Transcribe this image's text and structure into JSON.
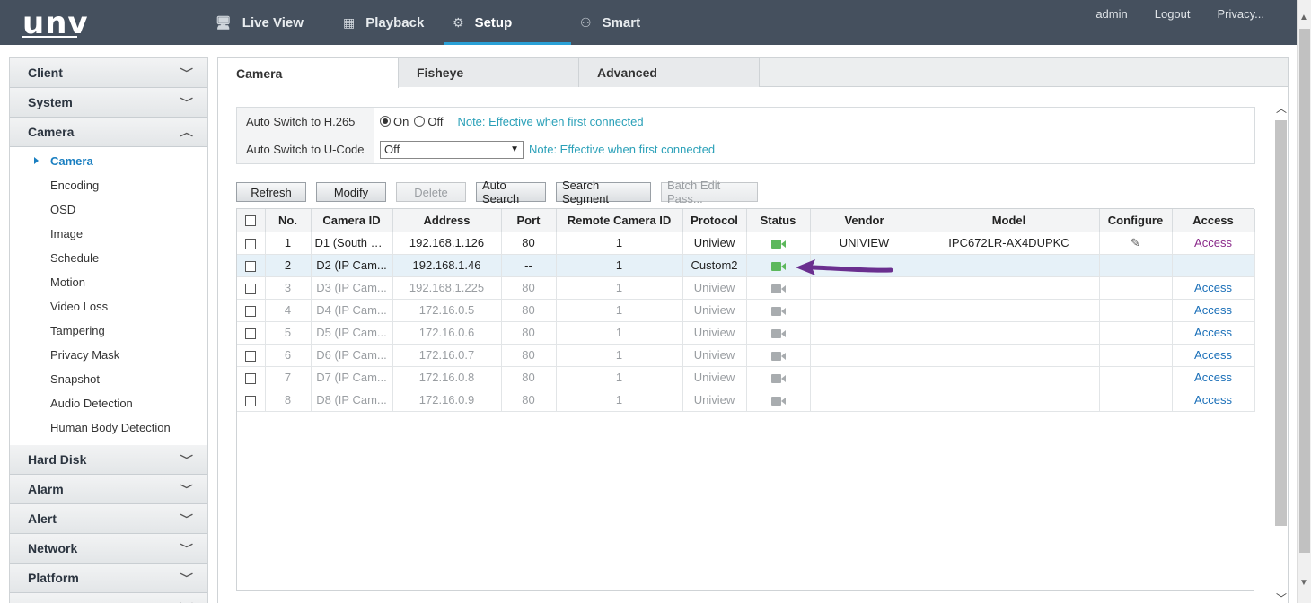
{
  "header": {
    "logo": "unv",
    "nav": [
      {
        "label": "Live View",
        "icon": "monitor-icon",
        "glyph": "🖥"
      },
      {
        "label": "Playback",
        "icon": "film-icon",
        "glyph": "▦"
      },
      {
        "label": "Setup",
        "icon": "gear-icon",
        "glyph": "⚙"
      },
      {
        "label": "Smart",
        "icon": "person-search-icon",
        "glyph": "⚇"
      }
    ],
    "active_nav": "Setup",
    "links": {
      "user": "admin",
      "logout": "Logout",
      "privacy": "Privacy..."
    }
  },
  "sidebar": {
    "groups_top": [
      "Client",
      "System"
    ],
    "camera_group": "Camera",
    "camera_items": [
      "Camera",
      "Encoding",
      "OSD",
      "Image",
      "Schedule",
      "Motion",
      "Video Loss",
      "Tampering",
      "Privacy Mask",
      "Snapshot",
      "Audio Detection",
      "Human Body Detection"
    ],
    "active_item": "Camera",
    "groups_bottom": [
      "Hard Disk",
      "Alarm",
      "Alert",
      "Network",
      "Platform",
      "User"
    ]
  },
  "tabs": [
    "Camera",
    "Fisheye",
    "Advanced"
  ],
  "active_tab": "Camera",
  "settings": {
    "h265": {
      "label": "Auto Switch to H.265",
      "on": "On",
      "off": "Off",
      "selected": "On",
      "note": "Note: Effective when first connected"
    },
    "ucode": {
      "label": "Auto Switch to U-Code",
      "value": "Off",
      "note": "Note: Effective when first connected"
    }
  },
  "buttons": [
    {
      "label": "Refresh",
      "enabled": true
    },
    {
      "label": "Modify",
      "enabled": true
    },
    {
      "label": "Delete",
      "enabled": false
    },
    {
      "label": "Auto Search",
      "enabled": true
    },
    {
      "label": "Search Segment",
      "enabled": true
    },
    {
      "label": "Batch Edit Pass...",
      "enabled": false
    }
  ],
  "table": {
    "headers": [
      "No.",
      "Camera ID",
      "Address",
      "Port",
      "Remote Camera ID",
      "Protocol",
      "Status",
      "Vendor",
      "Model",
      "Configure",
      "Access"
    ],
    "rows": [
      {
        "no": "1",
        "camera_id": "D1 (South D...",
        "address": "192.168.1.126",
        "port": "80",
        "remote_id": "1",
        "protocol": "Uniview",
        "status": "online",
        "vendor": "UNIVIEW",
        "model": "IPC672LR-AX4DUPKC",
        "configure": true,
        "access": "Access",
        "access_visited": true
      },
      {
        "no": "2",
        "camera_id": "D2 (IP Cam...",
        "address": "192.168.1.46",
        "port": "--",
        "remote_id": "1",
        "protocol": "Custom2",
        "status": "online",
        "vendor": "",
        "model": "",
        "configure": false,
        "access": "",
        "selected": true
      },
      {
        "no": "3",
        "camera_id": "D3 (IP Cam...",
        "address": "192.168.1.225",
        "port": "80",
        "remote_id": "1",
        "protocol": "Uniview",
        "status": "offline",
        "vendor": "",
        "model": "",
        "configure": false,
        "access": "Access"
      },
      {
        "no": "4",
        "camera_id": "D4 (IP Cam...",
        "address": "172.16.0.5",
        "port": "80",
        "remote_id": "1",
        "protocol": "Uniview",
        "status": "offline",
        "vendor": "",
        "model": "",
        "configure": false,
        "access": "Access"
      },
      {
        "no": "5",
        "camera_id": "D5 (IP Cam...",
        "address": "172.16.0.6",
        "port": "80",
        "remote_id": "1",
        "protocol": "Uniview",
        "status": "offline",
        "vendor": "",
        "model": "",
        "configure": false,
        "access": "Access"
      },
      {
        "no": "6",
        "camera_id": "D6 (IP Cam...",
        "address": "172.16.0.7",
        "port": "80",
        "remote_id": "1",
        "protocol": "Uniview",
        "status": "offline",
        "vendor": "",
        "model": "",
        "configure": false,
        "access": "Access"
      },
      {
        "no": "7",
        "camera_id": "D7 (IP Cam...",
        "address": "172.16.0.8",
        "port": "80",
        "remote_id": "1",
        "protocol": "Uniview",
        "status": "offline",
        "vendor": "",
        "model": "",
        "configure": false,
        "access": "Access"
      },
      {
        "no": "8",
        "camera_id": "D8 (IP Cam...",
        "address": "172.16.0.9",
        "port": "80",
        "remote_id": "1",
        "protocol": "Uniview",
        "status": "offline",
        "vendor": "",
        "model": "",
        "configure": false,
        "access": "Access"
      }
    ]
  },
  "annotation": {
    "color": "#6a2f8f"
  }
}
